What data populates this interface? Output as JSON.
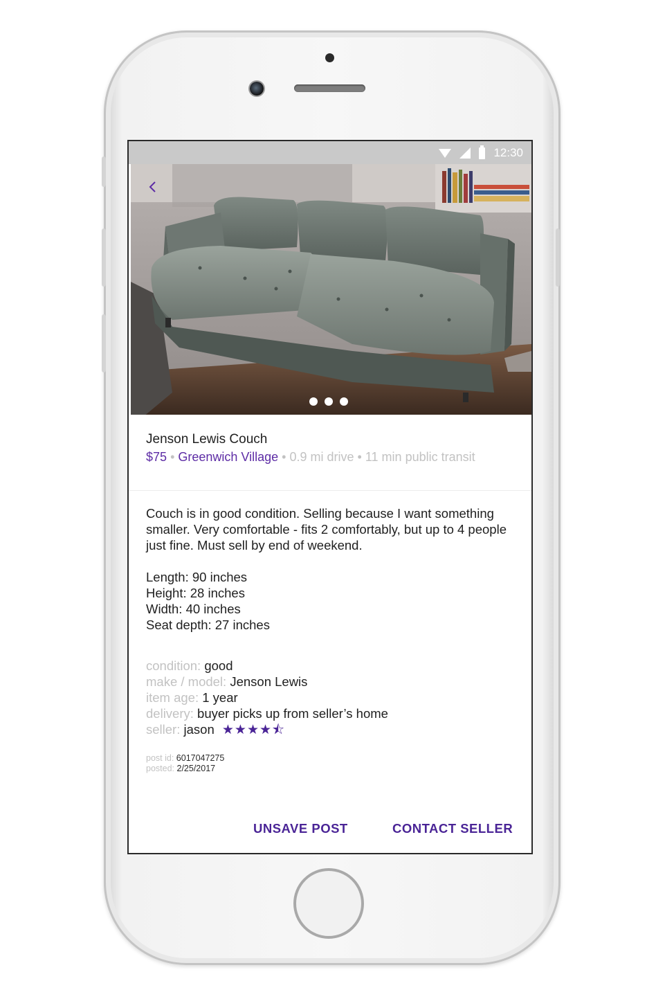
{
  "status_bar": {
    "time": "12:30"
  },
  "listing": {
    "title": "Jenson Lewis Couch",
    "price": "$75",
    "neighborhood": "Greenwich Village",
    "drive": "0.9 mi drive",
    "transit": "11 min public transit",
    "separator": "•",
    "photo_count": 3,
    "description": "Couch is in good condition. Selling because I want something smaller. Very comfortable - fits 2 comfortably, but up to 4 people just fine. Must sell by end of weekend.",
    "dimensions": [
      "Length: 90 inches",
      "Height: 28 inches",
      "Width: 40 inches",
      "Seat depth: 27 inches"
    ],
    "properties": {
      "condition": {
        "label": "condition:",
        "value": "good"
      },
      "make_model": {
        "label": "make / model:",
        "value": "Jenson Lewis"
      },
      "item_age": {
        "label": "item age:",
        "value": "1 year"
      },
      "delivery": {
        "label": "delivery:",
        "value": "buyer picks up from seller’s home"
      },
      "seller": {
        "label": "seller:",
        "value": "jason",
        "rating": 4.5,
        "rating_max": 5,
        "stars_text": "★★★★⯪"
      }
    },
    "post_id": {
      "label": "post id:",
      "value": "6017047275"
    },
    "posted": {
      "label": "posted:",
      "value": "2/25/2017"
    }
  },
  "actions": {
    "unsave_label": "UNSAVE POST",
    "contact_label": "CONTACT SELLER"
  },
  "colors": {
    "accent": "#5d2ca5",
    "muted": "#c2c2c2",
    "status_bar": "#c9c9c9"
  },
  "icons": {
    "back": "chevron-left-icon",
    "wifi": "wifi-icon",
    "signal": "signal-icon",
    "battery": "battery-icon"
  }
}
